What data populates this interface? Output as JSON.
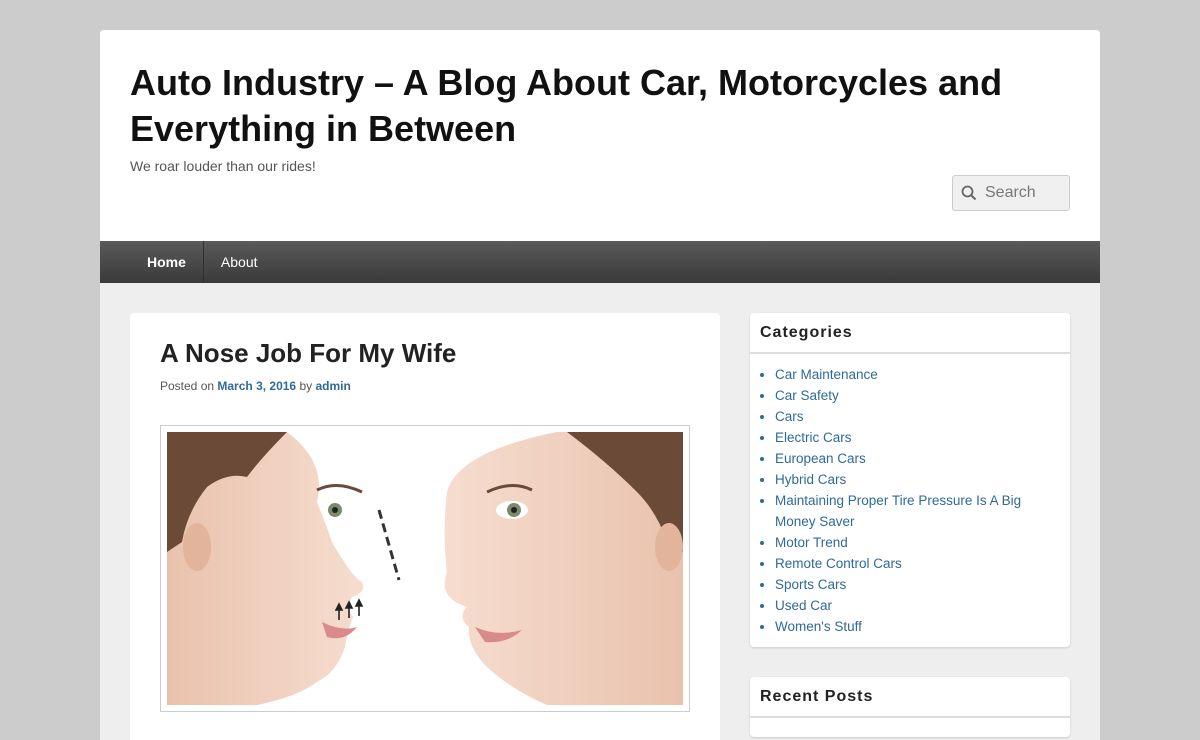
{
  "header": {
    "site_title": "Auto Industry – A Blog About Car, Motorcycles and Everything in Between",
    "tagline": "We roar louder than our rides!",
    "search_placeholder": "Search"
  },
  "nav": {
    "items": [
      {
        "label": "Home",
        "active": true
      },
      {
        "label": "About",
        "active": false
      }
    ]
  },
  "post": {
    "title": "A Nose Job For My Wife",
    "posted_on_label": "Posted on",
    "date": "March 3, 2016",
    "by_label": "by",
    "author": "admin",
    "image_alt": "rhinoplasty-illustration"
  },
  "sidebar": {
    "categories": {
      "title": "Categories",
      "items": [
        "Car Maintenance",
        "Car Safety",
        "Cars",
        "Electric Cars",
        "European Cars",
        "Hybrid Cars",
        "Maintaining Proper Tire Pressure Is A Big Money Saver",
        "Motor Trend",
        "Remote Control Cars",
        "Sports Cars",
        "Used Car",
        "Women's Stuff"
      ]
    },
    "recent_posts": {
      "title": "Recent Posts"
    }
  },
  "colors": {
    "background": "#cccccc",
    "link": "#2f6a99",
    "nav_bar": "#4a4a4a"
  }
}
